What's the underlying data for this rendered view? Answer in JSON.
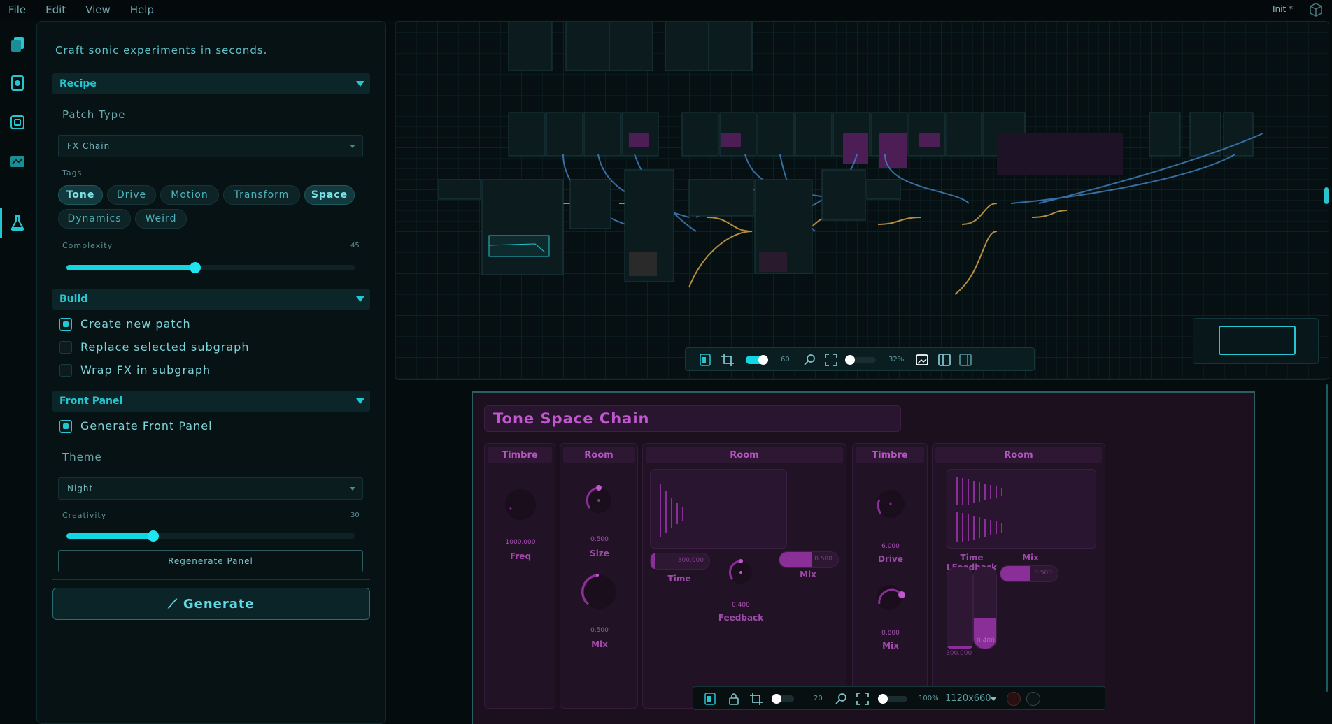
{
  "menu": {
    "file": "File",
    "edit": "Edit",
    "view": "View",
    "help": "Help",
    "preset": "Init *"
  },
  "sidebar": {
    "tagline": "Craft sonic experiments in seconds.",
    "recipe": {
      "header": "Recipe",
      "patch_type_label": "Patch Type",
      "patch_type_value": "FX Chain",
      "tags_label": "Tags",
      "tags": [
        {
          "label": "Tone",
          "on": true
        },
        {
          "label": "Drive",
          "on": false
        },
        {
          "label": "Motion",
          "on": false
        },
        {
          "label": "Transform",
          "on": false
        },
        {
          "label": "Space",
          "on": true
        },
        {
          "label": "Dynamics",
          "on": false
        },
        {
          "label": "Weird",
          "on": false
        }
      ],
      "complexity_label": "Complexity",
      "complexity_value": "45"
    },
    "build": {
      "header": "Build",
      "options": [
        {
          "label": "Create new patch",
          "checked": true
        },
        {
          "label": "Replace selected subgraph",
          "checked": false
        },
        {
          "label": "Wrap FX in subgraph",
          "checked": false
        }
      ]
    },
    "front_panel": {
      "header": "Front Panel",
      "generate_label": "Generate Front Panel",
      "theme_label": "Theme",
      "theme_value": "Night",
      "creativity_label": "Creativity",
      "creativity_value": "30",
      "regenerate_label": "Regenerate Panel"
    },
    "generate_label": "Generate"
  },
  "graph": {
    "zoom_value": "60",
    "zoom_percent": "32%",
    "fill_level": 0.6,
    "zoom_level": 0.1
  },
  "front_panel_view": {
    "title": "Tone Space Chain",
    "groups": [
      {
        "name": "Timbre",
        "knobs": [
          {
            "value": "1000.000",
            "label": "Freq"
          }
        ]
      },
      {
        "name": "Room",
        "knobs": [
          {
            "value": "0.500",
            "label": "Size"
          },
          {
            "value": "0.500",
            "label": "Mix"
          }
        ]
      },
      {
        "name": "Room",
        "controls": {
          "time_value": "300.000",
          "time_label": "Time",
          "feedback_value": "0.400",
          "feedback_label": "Feedback",
          "mix_value": "0.500",
          "mix_label": "Mix"
        }
      },
      {
        "name": "Timbre",
        "knobs": [
          {
            "value": "6.000",
            "label": "Drive"
          },
          {
            "value": "0.800",
            "label": "Mix"
          }
        ]
      },
      {
        "name": "Room",
        "controls": {
          "time_label": "Time L",
          "feedback_label": "Feedback",
          "mix_label": "Mix",
          "mix_value": "0.500",
          "time_value": "300.000",
          "feedback_value": "0.400"
        }
      }
    ],
    "toolbar": {
      "zoom_value": "20",
      "zoom_percent": "100%",
      "size": "1120x660"
    }
  },
  "colors": {
    "accent": "#26c6d0",
    "panel_accent": "#c257cf",
    "background": "#050c0e"
  }
}
